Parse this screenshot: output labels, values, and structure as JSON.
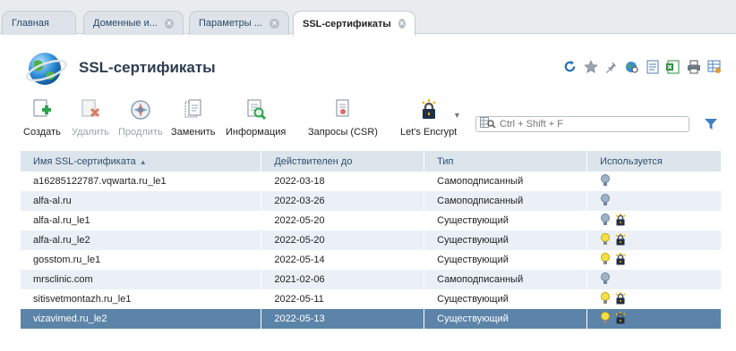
{
  "tabs": [
    {
      "label": "Главная",
      "closable": false
    },
    {
      "label": "Доменные и...",
      "closable": true
    },
    {
      "label": "Параметры ...",
      "closable": true
    },
    {
      "label": "SSL-сертификаты",
      "closable": true,
      "active": true
    }
  ],
  "header": {
    "title": "SSL-сертификаты"
  },
  "header_icons": [
    "refresh-icon",
    "star-icon",
    "pin-icon",
    "globe-search-icon",
    "document-icon",
    "excel-icon",
    "print-icon",
    "table-settings-icon"
  ],
  "toolbar": {
    "create": "Создать",
    "delete": "Удалить",
    "renew": "Продлить",
    "replace": "Заменить",
    "info": "Информация",
    "csr": "Запросы (CSR)",
    "letsencrypt": "Let's Encrypt"
  },
  "search": {
    "placeholder": "Ctrl + Shift + F"
  },
  "table": {
    "columns": [
      "Имя SSL-сертификата",
      "Действителен до",
      "Тип",
      "Используется"
    ],
    "rows": [
      {
        "name": "a16285122787.vqwarta.ru_le1",
        "valid": "2022-03-18",
        "type": "Самоподписанный",
        "kind": "self",
        "icons": [
          "grey"
        ]
      },
      {
        "name": "alfa-al.ru",
        "valid": "2022-03-26",
        "type": "Самоподписанный",
        "kind": "self",
        "icons": [
          "grey"
        ]
      },
      {
        "name": "alfa-al.ru_le1",
        "valid": "2022-05-20",
        "type": "Существующий",
        "kind": "existing",
        "icons": [
          "grey",
          "lock"
        ]
      },
      {
        "name": "alfa-al.ru_le2",
        "valid": "2022-05-20",
        "type": "Существующий",
        "kind": "existing",
        "icons": [
          "yellow",
          "lock"
        ]
      },
      {
        "name": "gosstom.ru_le1",
        "valid": "2022-05-14",
        "type": "Существующий",
        "kind": "existing",
        "icons": [
          "yellow",
          "lock"
        ]
      },
      {
        "name": "mrsclinic.com",
        "valid": "2021-02-06",
        "type": "Самоподписанный",
        "kind": "self",
        "icons": [
          "grey"
        ]
      },
      {
        "name": "sitisvetmontazh.ru_le1",
        "valid": "2022-05-11",
        "type": "Существующий",
        "kind": "existing",
        "icons": [
          "yellow",
          "lock"
        ]
      },
      {
        "name": "vizavimed.ru_le2",
        "valid": "2022-05-13",
        "type": "Существующий",
        "kind": "existing",
        "icons": [
          "yellow",
          "lock"
        ],
        "selected": true
      }
    ]
  }
}
